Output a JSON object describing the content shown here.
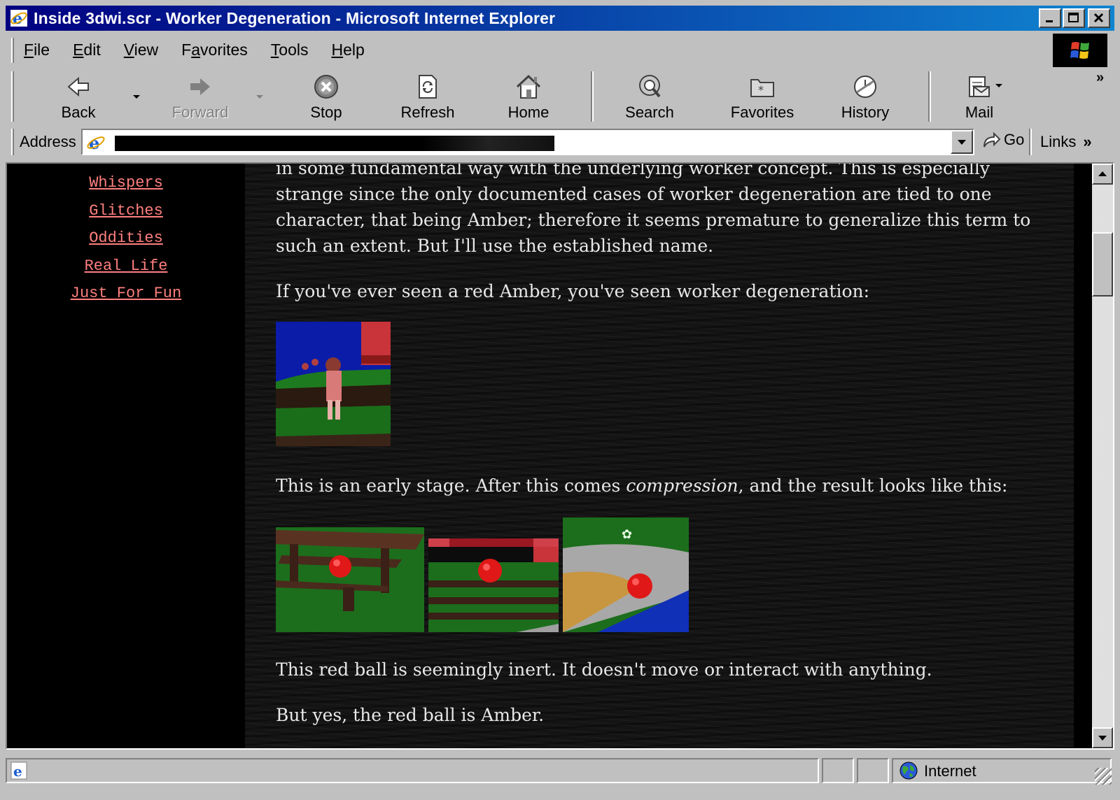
{
  "window": {
    "title": "Inside 3dwi.scr - Worker Degeneration - Microsoft Internet Explorer"
  },
  "menu": {
    "items": [
      {
        "label": "File",
        "accel": "F",
        "rest": "ile"
      },
      {
        "label": "Edit",
        "accel": "E",
        "rest": "dit"
      },
      {
        "label": "View",
        "accel": "V",
        "rest": "iew"
      },
      {
        "label": "Favorites",
        "pre": "F",
        "accel": "a",
        "rest": "vorites"
      },
      {
        "label": "Tools",
        "accel": "T",
        "rest": "ools"
      },
      {
        "label": "Help",
        "accel": "H",
        "rest": "elp"
      }
    ]
  },
  "toolbar": {
    "back": "Back",
    "forward": "Forward",
    "stop": "Stop",
    "refresh": "Refresh",
    "home": "Home",
    "search": "Search",
    "favorites": "Favorites",
    "history": "History",
    "mail": "Mail"
  },
  "address": {
    "label": "Address",
    "go": "Go",
    "links": "Links"
  },
  "sidebar": {
    "links": [
      "Whispers",
      "Glitches",
      "Oddities",
      "Real Life",
      "Just For Fun"
    ]
  },
  "article": {
    "p1": "in some fundamental way with the underlying worker concept. This is especially strange since the only documented cases of worker degeneration are tied to one character, that being Amber; therefore it seems premature to generalize this term to such an extent. But I'll use the established name.",
    "p2": "If you've ever seen a red Amber, you've seen worker degeneration:",
    "p3_before": "This is an early stage. After this comes ",
    "p3_em": "compression",
    "p3_after": ", and the result looks like this:",
    "p4": "This red ball is seemingly inert. It doesn't move or interact with anything.",
    "p5": "But yes, the red ball is Amber."
  },
  "status": {
    "zone": "Internet"
  },
  "colors": {
    "titlebar": "#000080",
    "link": "#ff7f7f",
    "chrome": "#c0c0c0",
    "body_text": "#e8e8e8"
  }
}
